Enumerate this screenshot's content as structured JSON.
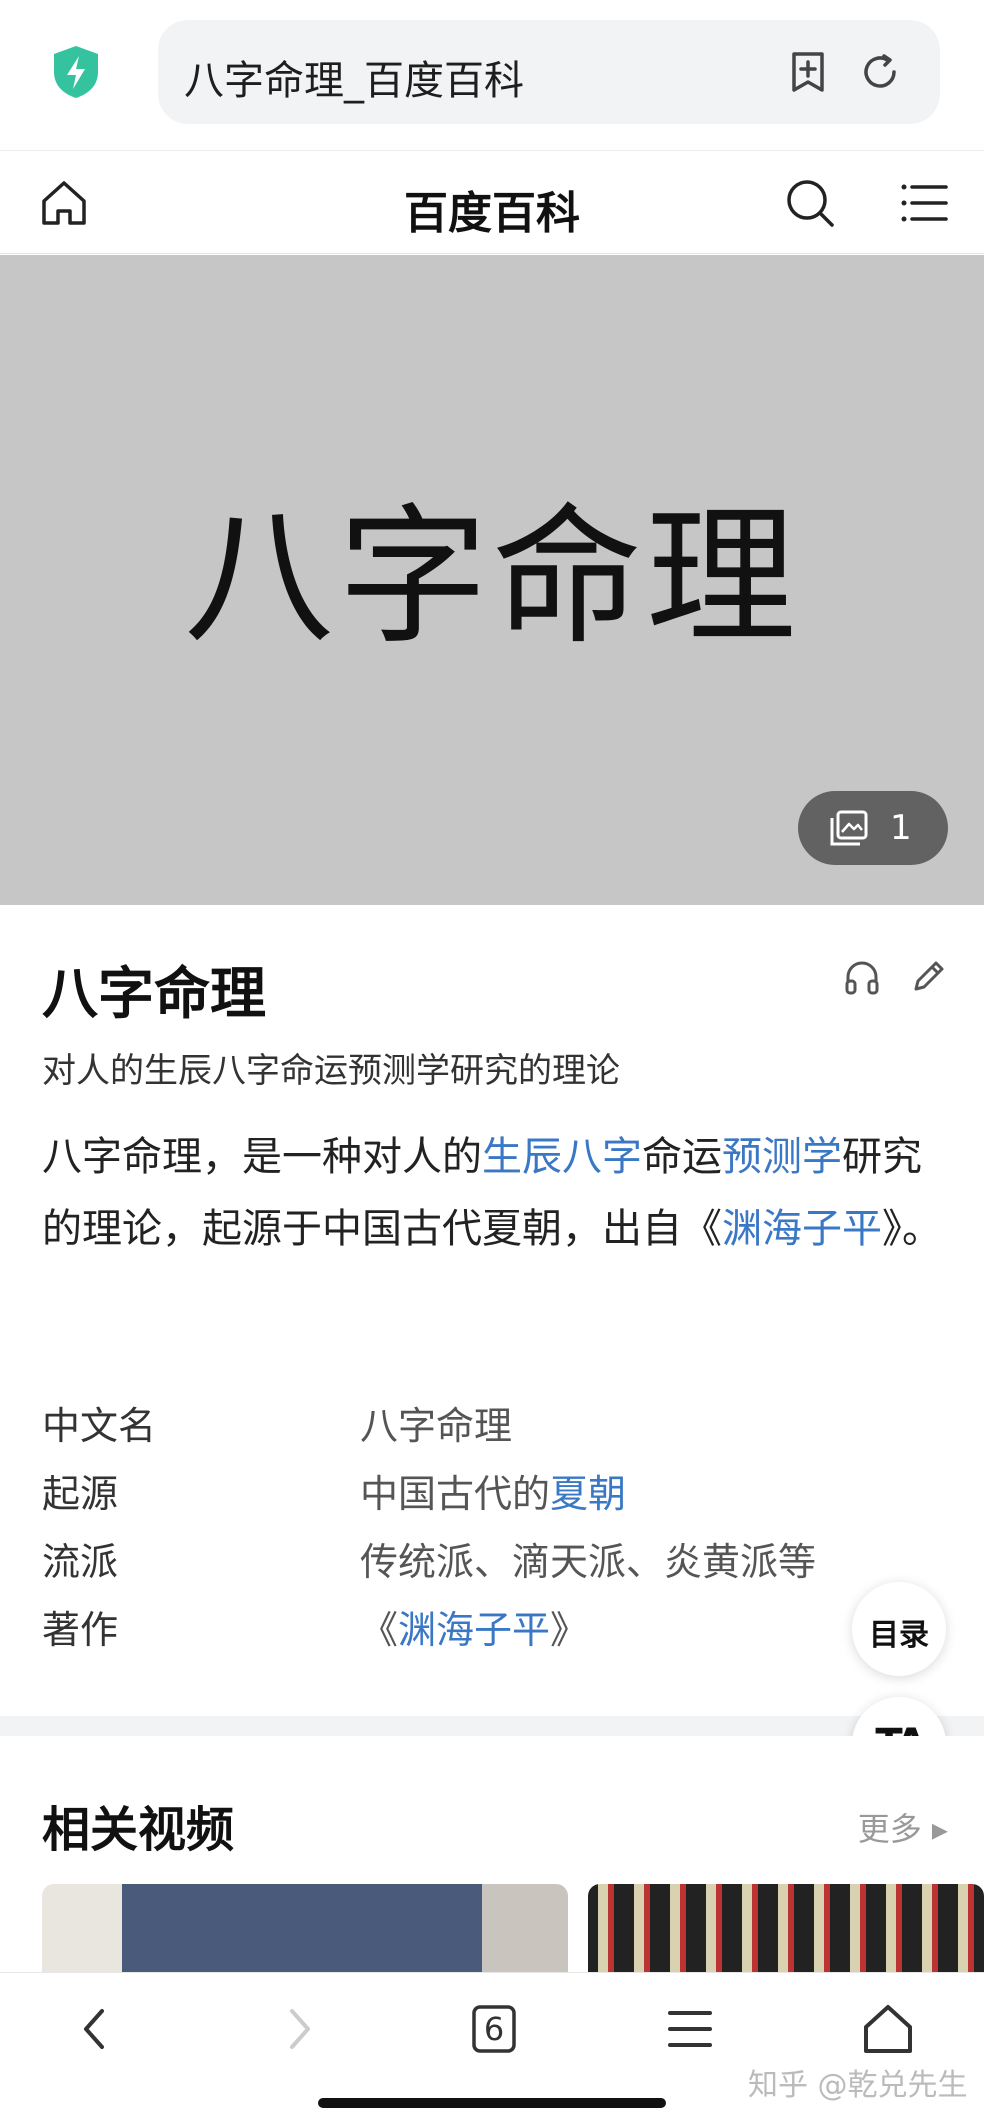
{
  "browser": {
    "url_text": "八字命理_百度百科"
  },
  "site": {
    "brand": "百度百科"
  },
  "hero": {
    "text": "八字命理",
    "album_count": "1"
  },
  "article": {
    "title": "八字命理",
    "subtitle": "对人的生辰八字命运预测学研究的理论",
    "summary": [
      {
        "text": "八字命理，是一种对人的",
        "link": false
      },
      {
        "text": "生辰八字",
        "link": true
      },
      {
        "text": "命运",
        "link": false
      },
      {
        "text": "预测学",
        "link": true
      },
      {
        "text": "研究的理论，起源于中国古代夏朝，出自《",
        "link": false
      },
      {
        "text": "渊海子平",
        "link": true
      },
      {
        "text": "》。",
        "link": false
      }
    ],
    "info": [
      {
        "label": "中文名",
        "value_parts": [
          {
            "text": "八字命理",
            "link": false
          }
        ]
      },
      {
        "label": "起源",
        "value_parts": [
          {
            "text": "中国古代的",
            "link": false
          },
          {
            "text": "夏朝",
            "link": true
          }
        ]
      },
      {
        "label": "流派",
        "value_parts": [
          {
            "text": "传统派、滴天派、炎黄派等",
            "link": false
          }
        ]
      },
      {
        "label": "著作",
        "value_parts": [
          {
            "text": "《",
            "link": false
          },
          {
            "text": "渊海子平",
            "link": true
          },
          {
            "text": "》",
            "link": false
          }
        ]
      }
    ]
  },
  "floating": {
    "toc_label": "目录",
    "ta_label": "TA"
  },
  "videos": {
    "title": "相关视频",
    "more": "更多 ▸"
  },
  "bottom_nav": {
    "tab_count": "6"
  },
  "watermark": "知乎 @乾兑先生",
  "colors": {
    "link": "#3a78c6",
    "shield": "#35c29e",
    "hero_bg": "#c6c6c6"
  }
}
